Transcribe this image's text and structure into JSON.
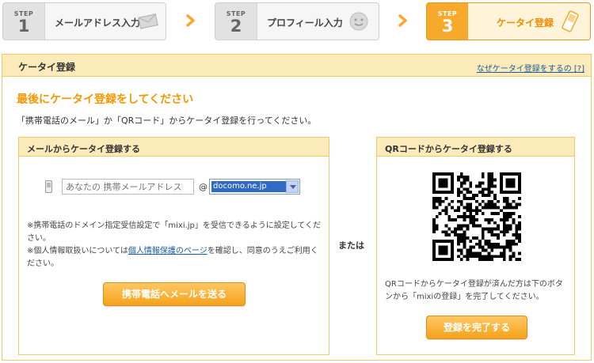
{
  "steps": [
    {
      "label": "STEP",
      "num": "1",
      "title": "メールアドレス入力"
    },
    {
      "label": "STEP",
      "num": "2",
      "title": "プロフィール入力"
    },
    {
      "label": "STEP",
      "num": "3",
      "title": "ケータイ登録"
    }
  ],
  "colors": {
    "accent": "#f6a92a",
    "lead": "#f39800",
    "link": "#1a5a9c",
    "panel": "#fbeaba"
  },
  "header": {
    "title": "ケータイ登録",
    "why_link": "なぜケータイ登録をするの [?]"
  },
  "lead": "最後にケータイ登録をしてください",
  "intro": "「携帯電話のメール」か「QRコード」からケータイ登録を行ってください。",
  "mail": {
    "heading": "メールからケータイ登録する",
    "placeholder": "あなたの 携帯メールアドレス",
    "at": "@",
    "domain": "docomo.ne.jp",
    "note1": "※携帯電話のドメイン指定受信設定で「mixi.jp」を受信できるように設定してください。",
    "note2_pre": "※個人情報取扱いについては",
    "note2_link": "個人情報保護のページ",
    "note2_post": "を確認し、同意のうえご利用ください。",
    "send_button": "携帯電話へメールを送る"
  },
  "or": "または",
  "qr": {
    "heading": "QRコードからケータイ登録する",
    "text": "QRコードからケータイ登録が済んだ方は下のボタンから「mixiの登録」を完了してください。",
    "complete_button": "登録を完了する"
  }
}
